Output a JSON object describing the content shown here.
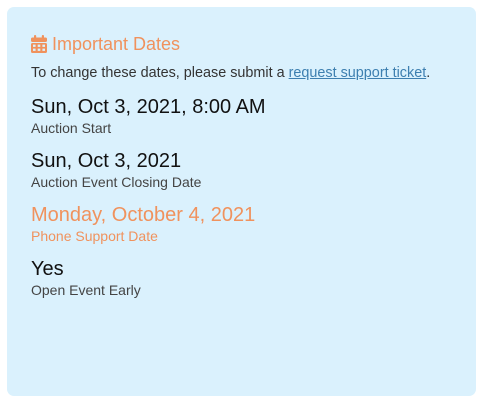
{
  "card": {
    "title": "Important Dates",
    "title_icon": "calendar-icon",
    "note_prefix": "To change these dates, please submit a ",
    "note_link": "request support ticket",
    "note_suffix": "."
  },
  "dates": [
    {
      "value": "Sun, Oct 3, 2021, 8:00 AM",
      "label": "Auction Start"
    },
    {
      "value": "Sun, Oct 3, 2021",
      "label": "Auction Event Closing Date"
    },
    {
      "value": "Monday, October 4, 2021",
      "label": "Phone Support Date"
    },
    {
      "value": "Yes",
      "label": "Open Event Early"
    }
  ],
  "colors": {
    "card_background": "#daf1fd",
    "accent": "#f0925d",
    "link": "#3d7fb0"
  }
}
